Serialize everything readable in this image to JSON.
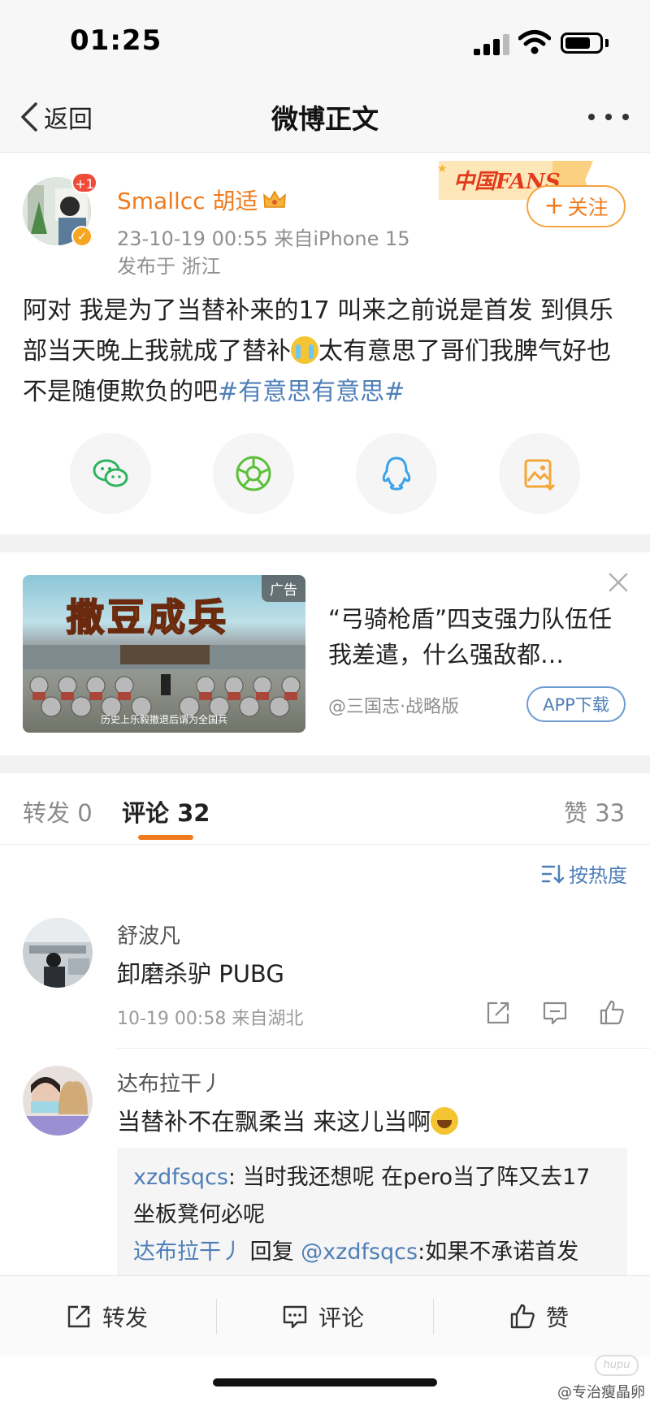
{
  "status_bar": {
    "time": "01:25"
  },
  "nav": {
    "back_label": "返回",
    "title": "微博正文"
  },
  "post": {
    "avatar_badge": "+1",
    "username": "Smallcc 胡适",
    "timestamp_source": "23-10-19 00:55  来自iPhone 15",
    "location": "发布于 浙江",
    "fans_banner": "中国FANS",
    "follow_label": "关注",
    "text_before_emoji": "阿对 我是为了当替补来的17 叫来之前说是首发 到俱乐部当天晚上我就成了替补",
    "text_after_emoji": "太有意思了哥们我脾气好也不是随便欺负的吧",
    "hashtag": "#有意思有意思#",
    "share_targets": [
      "wechat-icon",
      "moments-icon",
      "qq-icon",
      "save-image-icon"
    ]
  },
  "ad": {
    "image_title": "撒豆成兵",
    "image_caption": "历史上乐毅撤退后谓为全国兵",
    "tag": "广告",
    "headline": "“弓骑枪盾”四支强力队伍任我差遣，什么强敌都…",
    "source": "@三国志·战略版",
    "button_label": "APP下载"
  },
  "tabs": {
    "repost": "转发 0",
    "comments": "评论 32",
    "likes": "赞 33"
  },
  "sort_label": "按热度",
  "comments": [
    {
      "name": "舒波凡",
      "text": "卸磨杀驴 PUBG",
      "meta": "10-19 00:58  来自湖北"
    },
    {
      "name": "达布拉干丿",
      "text": "当替补不在飘柔当 来这儿当啊",
      "replies": [
        {
          "name": "xzdfsqcs",
          "text": ": 当时我还想呢 在pero当了阵又去17坐板凳何必呢"
        },
        {
          "name": "达布拉干丿",
          "reply_word": " 回复 ",
          "target": "@xzdfsqcs",
          "text": ":如果不承诺首发"
        }
      ]
    }
  ],
  "bottom_bar": {
    "repost": "转发",
    "comment": "评论",
    "like": "赞"
  },
  "watermark": "@专治瘦晶卵",
  "watermark_logo": "hupu",
  "colors": {
    "orange": "#f07b1e",
    "link_blue": "#4f7fb7",
    "gray_text": "#8f8f8f"
  }
}
